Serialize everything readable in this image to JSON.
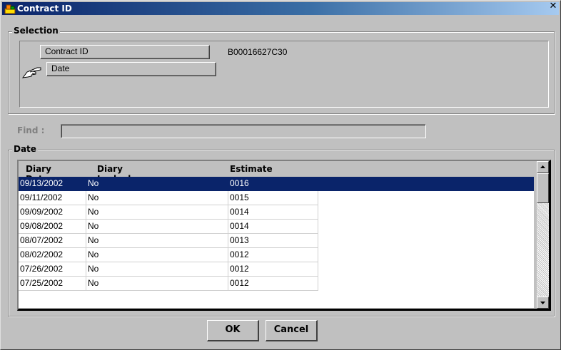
{
  "window": {
    "title": "Contract ID",
    "close_glyph": "✕",
    "icon": "app-icon"
  },
  "selection": {
    "label": "Selection",
    "contract_id_label": "Contract ID",
    "contract_id_value": "B00016627C30",
    "date_label": "Date",
    "pointer_icon": "pointing-hand-icon"
  },
  "find": {
    "label": "Find :",
    "value": ""
  },
  "date_group": {
    "label": "Date",
    "columns": [
      "Diary Date",
      "Diary Locked Indicator",
      "Estimate"
    ],
    "rows": [
      [
        "09/13/2002",
        "No",
        "0016"
      ],
      [
        "09/11/2002",
        "No",
        "0015"
      ],
      [
        "09/09/2002",
        "No",
        "0014"
      ],
      [
        "09/08/2002",
        "No",
        "0014"
      ],
      [
        "08/07/2002",
        "No",
        "0013"
      ],
      [
        "08/02/2002",
        "No",
        "0012"
      ],
      [
        "07/26/2002",
        "No",
        "0012"
      ],
      [
        "07/25/2002",
        "No",
        "0012"
      ]
    ],
    "selected_row": 0
  },
  "buttons": {
    "ok": "OK",
    "cancel": "Cancel"
  },
  "colors": {
    "title_start": "#0a246a",
    "title_end": "#a6caf0",
    "selection": "#0a246a",
    "face": "#c0c0c0"
  }
}
